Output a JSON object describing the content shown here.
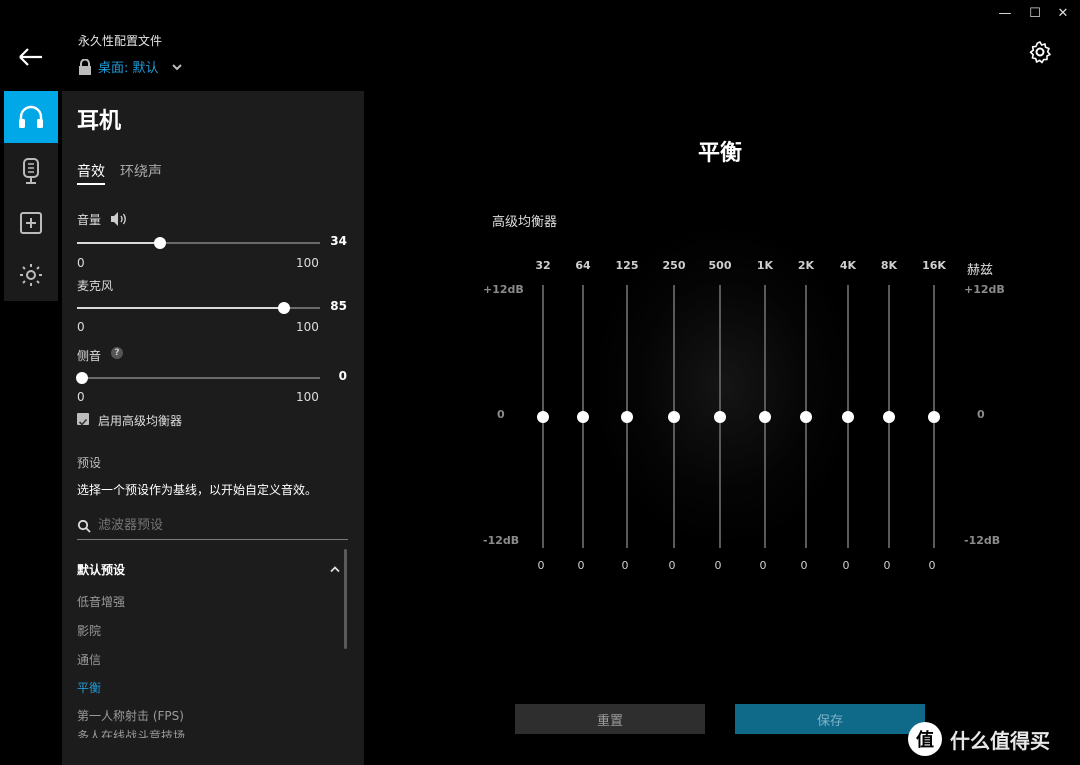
{
  "window": {
    "minimize": "—",
    "maximize": "☐",
    "close": "✕"
  },
  "header": {
    "profile_title": "永久性配置文件",
    "profile_name": "桌面: 默认"
  },
  "panel": {
    "title": "耳机",
    "tabs": [
      "音效",
      "环绕声"
    ],
    "volume": {
      "label": "音量",
      "value": "34",
      "level": 0.34,
      "min": "0",
      "max": "100"
    },
    "mic": {
      "label": "麦克风",
      "value": "85",
      "level": 0.85,
      "min": "0",
      "max": "100"
    },
    "sidetone": {
      "label": "侧音",
      "help": "?",
      "value": "0",
      "level": 0.0,
      "min": "0",
      "max": "100"
    },
    "advanced_eq_label": "启用高级均衡器",
    "presets_heading": "预设",
    "presets_hint": "选择一个预设作为基线，以开始自定义音效。",
    "search_placeholder": "滤波器预设",
    "default_group": "默认预设",
    "presets": [
      "低音增强",
      "影院",
      "通信",
      "平衡",
      "第一人称射击 (FPS)",
      "多人在线战斗竞技场"
    ],
    "selected_preset_index": 3
  },
  "main": {
    "title": "平衡",
    "eq_caption": "高级均衡器",
    "unit": "赫兹",
    "db_top": "+12dB",
    "db_mid": "0",
    "db_bottom": "-12dB",
    "bands": [
      {
        "freq": "32",
        "gain": "0"
      },
      {
        "freq": "64",
        "gain": "0"
      },
      {
        "freq": "125",
        "gain": "0"
      },
      {
        "freq": "250",
        "gain": "0"
      },
      {
        "freq": "500",
        "gain": "0"
      },
      {
        "freq": "1K",
        "gain": "0"
      },
      {
        "freq": "2K",
        "gain": "0"
      },
      {
        "freq": "4K",
        "gain": "0"
      },
      {
        "freq": "8K",
        "gain": "0"
      },
      {
        "freq": "16K",
        "gain": "0"
      }
    ],
    "reset_label": "重置",
    "save_label": "保存"
  },
  "watermark": {
    "text": "什么值得买",
    "badge": "值"
  },
  "colors": {
    "accent": "#00a8e8",
    "link": "#1e9bd7",
    "save": "#0f6a8a"
  }
}
